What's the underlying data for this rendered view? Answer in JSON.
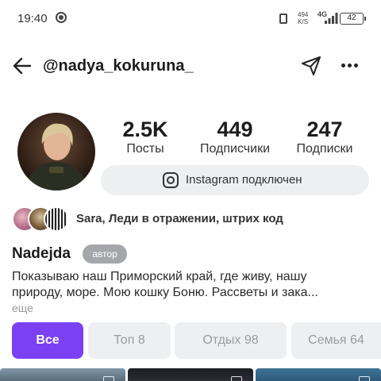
{
  "status_bar": {
    "time": "19:40",
    "net_speed_value": "494",
    "net_speed_unit": "K/S",
    "network": "4G",
    "battery": "42"
  },
  "header": {
    "username": "@nadya_kokuruna_"
  },
  "profile": {
    "stats": [
      {
        "value": "2.5K",
        "label": "Посты"
      },
      {
        "value": "449",
        "label": "Подписчики"
      },
      {
        "value": "247",
        "label": "Подписки"
      }
    ],
    "instagram_label": "Instagram подключен",
    "mutual_text": "Sara, Леди в отражении, штрих код",
    "name": "Nadejda",
    "role_badge": "автор",
    "bio_line1": "Показываю наш Приморский край, где живу, нашу",
    "bio_line2": "природу, море. Мою кошку Боню. Рассветы и зака...",
    "more_link": "еще"
  },
  "tabs": [
    {
      "label": "Все",
      "count": ""
    },
    {
      "label": "Топ",
      "count": "8"
    },
    {
      "label": "Отдых",
      "count": "98"
    },
    {
      "label": "Семья",
      "count": "64"
    }
  ],
  "colors": {
    "accent": "#7a40f2",
    "pill_bg": "#eeeff1",
    "badge_bg": "#a5a6aa"
  },
  "icons": [
    "back-arrow-icon",
    "send-icon",
    "more-dots-icon",
    "instagram-icon"
  ]
}
